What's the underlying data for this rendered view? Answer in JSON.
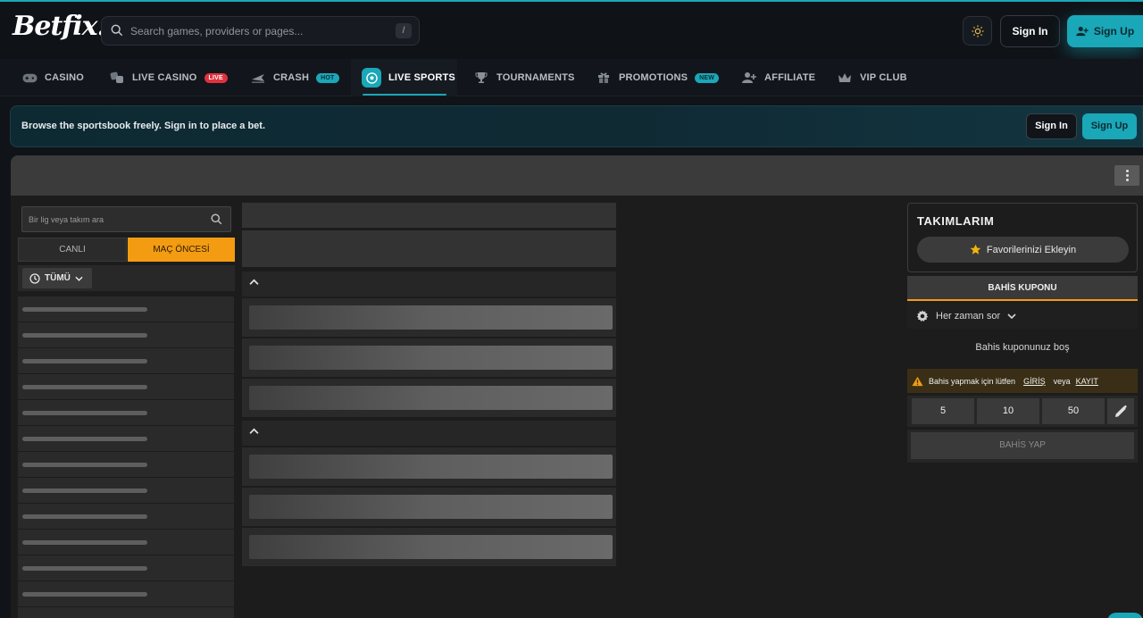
{
  "header": {
    "logo": "Betfix.",
    "search_placeholder": "Search games, providers or pages...",
    "search_shortcut": "/",
    "signin": "Sign In",
    "signup": "Sign Up"
  },
  "nav": {
    "items": [
      {
        "label": "CASINO",
        "icon": "gamepad-icon"
      },
      {
        "label": "LIVE CASINO",
        "icon": "dice-icon",
        "badge": "LIVE"
      },
      {
        "label": "CRASH",
        "icon": "plane-icon",
        "badge": "HOT"
      },
      {
        "label": "LIVE SPORTS",
        "icon": "soccer-ball-icon",
        "active": true
      },
      {
        "label": "TOURNAMENTS",
        "icon": "trophy-icon"
      },
      {
        "label": "PROMOTIONS",
        "icon": "gift-icon",
        "badge": "NEW"
      },
      {
        "label": "AFFILIATE",
        "icon": "user-plus-icon"
      },
      {
        "label": "VIP CLUB",
        "icon": "crown-icon"
      }
    ]
  },
  "banner": {
    "text": "Browse the sportsbook freely. Sign in to place a bet.",
    "signin": "Sign In",
    "signup": "Sign Up"
  },
  "left": {
    "search_placeholder": "Bir lig veya takım ara",
    "tab_live": "CANLI",
    "tab_prematch": "MAÇ ÖNCESİ",
    "filter": "TÜMÜ"
  },
  "right": {
    "teams_title": "TAKIMLARIM",
    "fav_button": "Favorilerinizi Ekleyin",
    "coupon_tab": "BAHİS KUPONU",
    "ask_setting": "Her zaman sor",
    "empty": "Bahis kuponunuz boş",
    "warn_text": "Bahis yapmak için lütfen",
    "warn_login": "GİRİŞ",
    "warn_or": "veya",
    "warn_register": "KAYIT",
    "stakes": [
      "5",
      "10",
      "50"
    ],
    "place_bet": "BAHİS YAP"
  },
  "colors": {
    "accent": "#1aa7b8",
    "orange": "#f39c12",
    "live_badge": "#e0323e"
  }
}
